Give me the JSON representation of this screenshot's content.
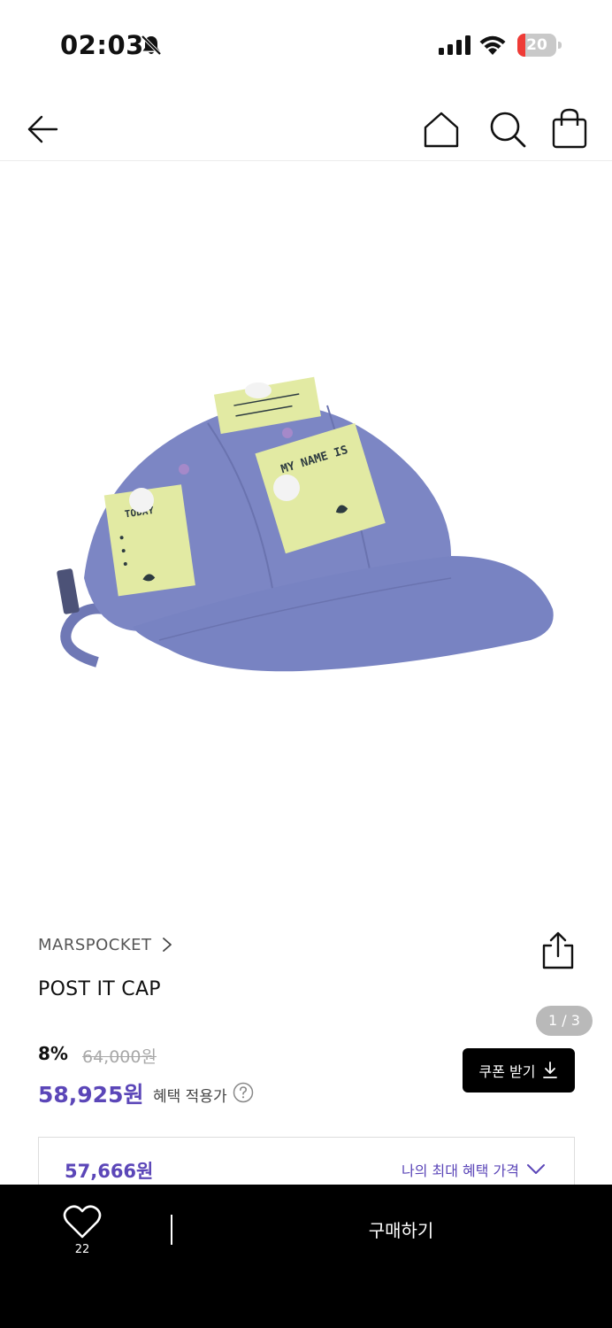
{
  "status_bar": {
    "time": "02:03",
    "battery_level": "20",
    "battery_fraction": 0.2,
    "icons": [
      "bell-slash-icon",
      "signal-icon",
      "wifi-icon",
      "battery-icon"
    ]
  },
  "nav": {
    "icons": [
      "back-arrow-icon",
      "home-icon",
      "search-icon",
      "shopping-bag-icon"
    ]
  },
  "gallery": {
    "counter": "1 / 3",
    "current": 1,
    "total": 3
  },
  "product": {
    "brand": "MARSPOCKET",
    "name": "POST IT CAP",
    "discount_rate": "8%",
    "original_price": "64,000원",
    "sale_price": "58,925원",
    "benefit_label": "혜택 적용가",
    "coupon_button": "쿠폰 받기",
    "max_price": "57,666원",
    "max_benefit_label": "나의 최대 혜택 가격"
  },
  "bottom_bar": {
    "like_count": "22",
    "buy_label": "구매하기"
  },
  "colors": {
    "accent": "#5b46b8",
    "battery_low": "#ef3b36",
    "cap": "#7c86c4",
    "note": "#e2eaa3"
  }
}
